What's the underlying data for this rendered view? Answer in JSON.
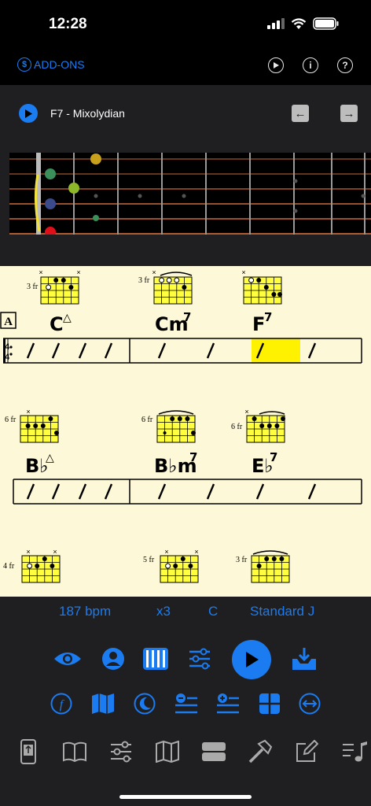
{
  "status": {
    "time": "12:28"
  },
  "topbar": {
    "addons_label": "ADD-ONS",
    "addons_symbol": "$",
    "info_symbol": "i",
    "help_symbol": "?"
  },
  "scale": {
    "title": "F7 - Mixolydian",
    "prev_symbol": "←",
    "next_symbol": "→"
  },
  "sheet": {
    "rehearsal_mark": "A",
    "time_signature": [
      "4",
      "4"
    ],
    "rows": [
      {
        "chords": [
          {
            "name": "C",
            "ext": "△",
            "fret": "3 fr"
          },
          {
            "name": "Cm",
            "ext": "7",
            "fret": "3 fr"
          },
          {
            "name": "F",
            "ext": "7",
            "fret": ""
          }
        ]
      },
      {
        "chords": [
          {
            "name": "B♭",
            "ext": "△",
            "fret": "6 fr"
          },
          {
            "name": "B♭m",
            "ext": "7",
            "fret": "6 fr"
          },
          {
            "name": "E♭",
            "ext": "7",
            "fret": "6 fr"
          }
        ]
      },
      {
        "chords": [
          {
            "name": "",
            "ext": "",
            "fret": "4 fr"
          },
          {
            "name": "",
            "ext": "",
            "fret": "5 fr"
          },
          {
            "name": "",
            "ext": "",
            "fret": "3 fr"
          }
        ]
      }
    ]
  },
  "player": {
    "tempo": "187 bpm",
    "repeat": "x3",
    "key": "C",
    "style": "Standard J"
  },
  "colors": {
    "accent": "#1a7cf0",
    "panel": "#1f1f21",
    "paper": "#fdf8d7",
    "highlight": "#fff200",
    "diagram": "#ffff40"
  },
  "icons": {
    "row1": [
      "eye-icon",
      "person-icon",
      "piano-icon",
      "mixer-icon",
      "play-icon",
      "inbox-download-icon"
    ],
    "row2": [
      "function-icon",
      "map-icon",
      "moon-icon",
      "remove-list-icon",
      "add-list-icon",
      "grid-icon",
      "swap-horizontal-icon"
    ],
    "tabs": [
      "device-tab-icon",
      "book-tab-icon",
      "sliders-tab-icon",
      "map-tab-icon",
      "layers-tab-icon",
      "hammer-tab-icon",
      "edit-tab-icon",
      "music-list-tab-icon"
    ]
  }
}
